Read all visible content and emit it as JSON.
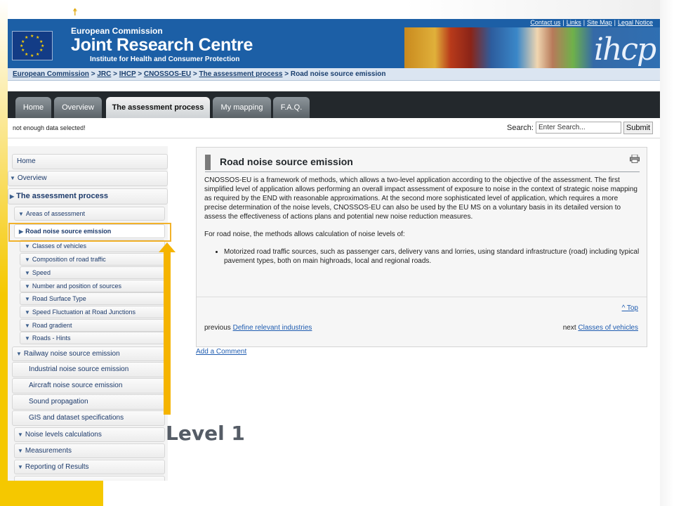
{
  "header": {
    "line1": "European Commission",
    "line2": "Joint Research Centre",
    "line3": "Institute for Health and Consumer Protection",
    "logo_text": "ihcp",
    "links": [
      "Contact us",
      "Links",
      "Site Map",
      "Legal Notice"
    ]
  },
  "breadcrumb": {
    "items": [
      "European Commission",
      "JRC",
      "IHCP",
      "CNOSSOS-EU",
      "The assessment process"
    ],
    "current": "Road noise source emission",
    "separator": ">"
  },
  "tabs": [
    {
      "label": "Home",
      "active": false
    },
    {
      "label": "Overview",
      "active": false
    },
    {
      "label": "The assessment process",
      "active": true
    },
    {
      "label": "My mapping",
      "active": false
    },
    {
      "label": "F.A.Q.",
      "active": false
    }
  ],
  "toolbar": {
    "status": "not enough data selected!",
    "search_label": "Search:",
    "search_value": "Enter Search...",
    "submit_label": "Submit"
  },
  "sidebar": {
    "items": [
      {
        "label": "Home",
        "icon": "none"
      },
      {
        "label": "Overview",
        "icon": "triangle-down"
      },
      {
        "label": "The assessment process",
        "icon": "triangle-right"
      },
      {
        "label": "Areas of assessment",
        "icon": "triangle-down"
      },
      {
        "label": "Road noise source emission",
        "icon": "triangle-right"
      },
      {
        "label": "Classes of vehicles",
        "icon": "triangle-down"
      },
      {
        "label": "Composition of road traffic",
        "icon": "triangle-down"
      },
      {
        "label": "Speed",
        "icon": "triangle-down"
      },
      {
        "label": "Number and position of sources",
        "icon": "triangle-down"
      },
      {
        "label": "Road Surface Type",
        "icon": "triangle-down"
      },
      {
        "label": "Speed Fluctuation at Road Junctions",
        "icon": "triangle-down"
      },
      {
        "label": "Road gradient",
        "icon": "triangle-down"
      },
      {
        "label": "Roads - Hints",
        "icon": "triangle-down"
      },
      {
        "label": "Railway noise source emission",
        "icon": "triangle-down"
      },
      {
        "label": "Industrial noise source emission",
        "icon": "none"
      },
      {
        "label": "Aircraft noise source emission",
        "icon": "none"
      },
      {
        "label": "Sound propagation",
        "icon": "none"
      },
      {
        "label": "GIS and dataset specifications",
        "icon": "none"
      },
      {
        "label": "Noise levels calculations",
        "icon": "triangle-down"
      },
      {
        "label": "Measurements",
        "icon": "triangle-down"
      },
      {
        "label": "Reporting of Results",
        "icon": "triangle-down"
      }
    ]
  },
  "content": {
    "title": "Road noise source emission",
    "paragraph1": "CNOSSOS-EU is a framework of methods, which allows a two-level application according to the objective of the assessment. The first simplified level of application allows performing an overall impact assessment of exposure to noise in the context of strategic noise mapping as required by the END with reasonable approximations. At the second more sophisticated level of application, which requires a more precise determination of the noise levels, CNOSSOS-EU can also be used by the EU MS on a voluntary basis in its detailed version to assess the effectiveness of actions plans and potential new noise reduction measures.",
    "paragraph2": "For road noise, the methods allows calculation of noise levels of:",
    "bullet1": "Motorized road traffic sources, such as passenger cars, delivery vans and lorries, using standard infrastructure (road) including typical pavement types, both on main highroads, local and regional roads.",
    "top_link": "^ Top",
    "prev_label": "previous",
    "prev_link": "Define relevant industries",
    "next_label": "next",
    "next_link": "Classes of vehicles"
  },
  "add_comment": "Add a Comment",
  "annotation": {
    "level_label": "Level 1"
  },
  "colors": {
    "header_blue": "#1c5fa6",
    "accent_yellow": "#f5b400",
    "tab_bar": "#23282c",
    "link_blue": "#1f5cb0"
  }
}
